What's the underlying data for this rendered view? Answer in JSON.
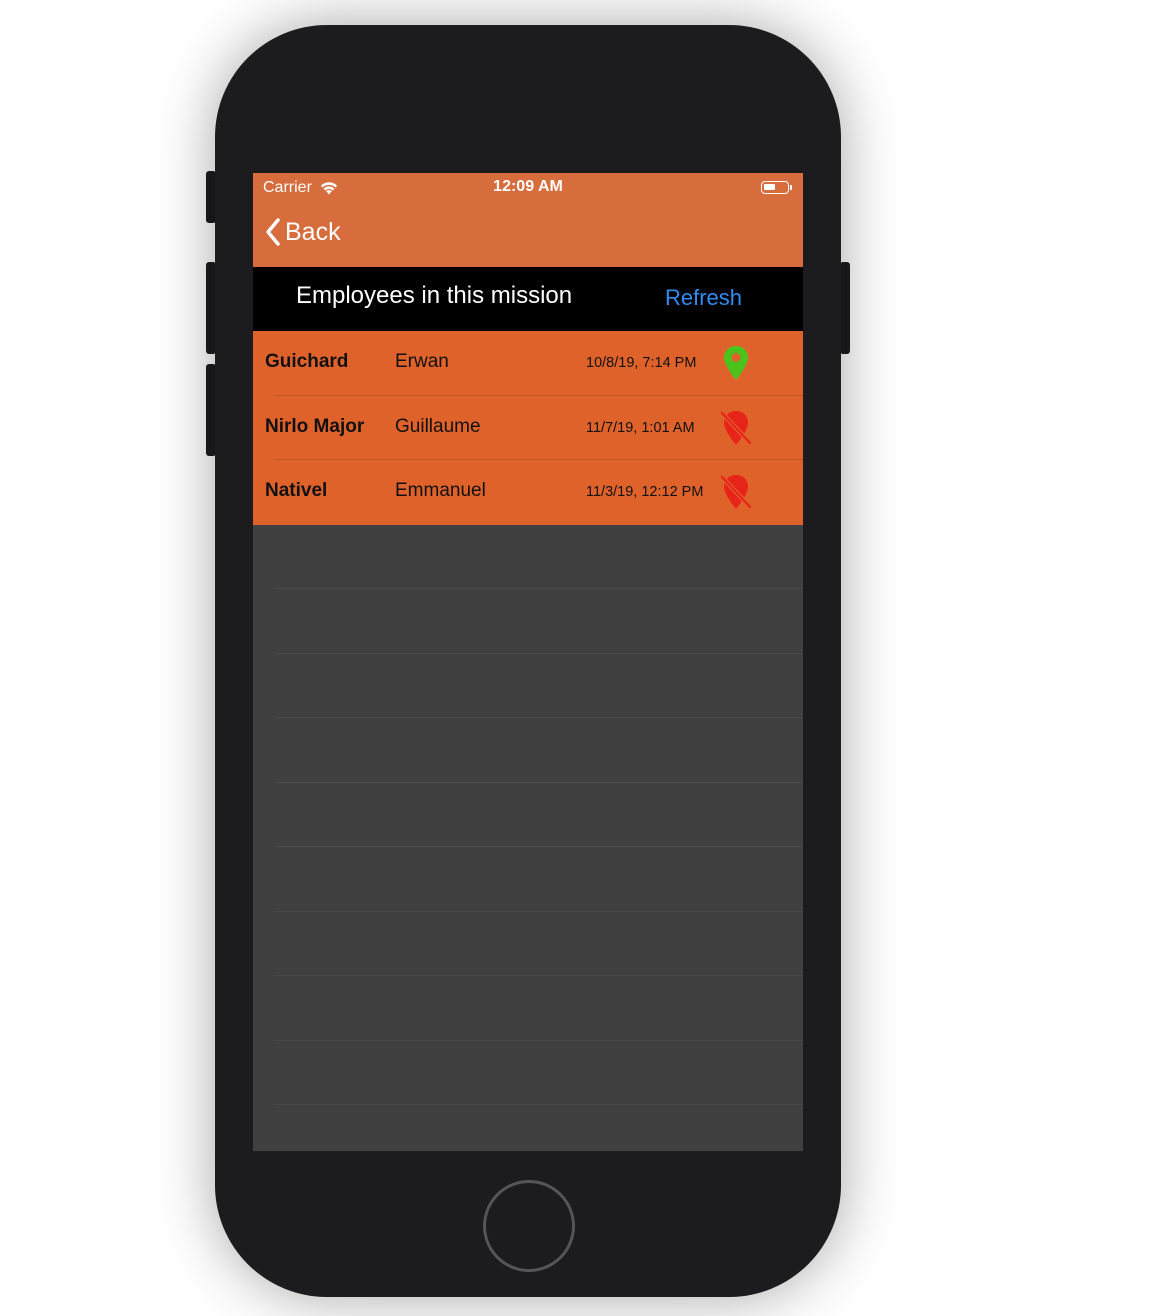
{
  "status_bar": {
    "carrier": "Carrier",
    "time": "12:09 AM",
    "wifi_icon": "wifi-icon",
    "battery_icon": "battery-icon"
  },
  "nav": {
    "back_label": "Back",
    "back_icon": "chevron-left-icon"
  },
  "header": {
    "title": "Employees in this mission",
    "refresh_label": "Refresh"
  },
  "employees": [
    {
      "last_name": "Guichard",
      "first_name": "Erwan",
      "timestamp": "10/8/19, 7:14 PM",
      "location_icon": "location-pin-icon",
      "location_active": true
    },
    {
      "last_name": "Nirlo Major",
      "first_name": "Guillaume",
      "timestamp": "11/7/19, 1:01 AM",
      "location_icon": "location-off-icon",
      "location_active": false
    },
    {
      "last_name": "Nativel",
      "first_name": "Emmanuel",
      "timestamp": "11/3/19, 12:12 PM",
      "location_icon": "location-off-icon",
      "location_active": false
    }
  ],
  "colors": {
    "navbar": "#d76c3d",
    "row": "#e0622b",
    "header": "#000000",
    "refresh": "#2f8cf5",
    "location_on": "#4cc21c",
    "location_off": "#e8231a",
    "empty_background": "#404040"
  }
}
